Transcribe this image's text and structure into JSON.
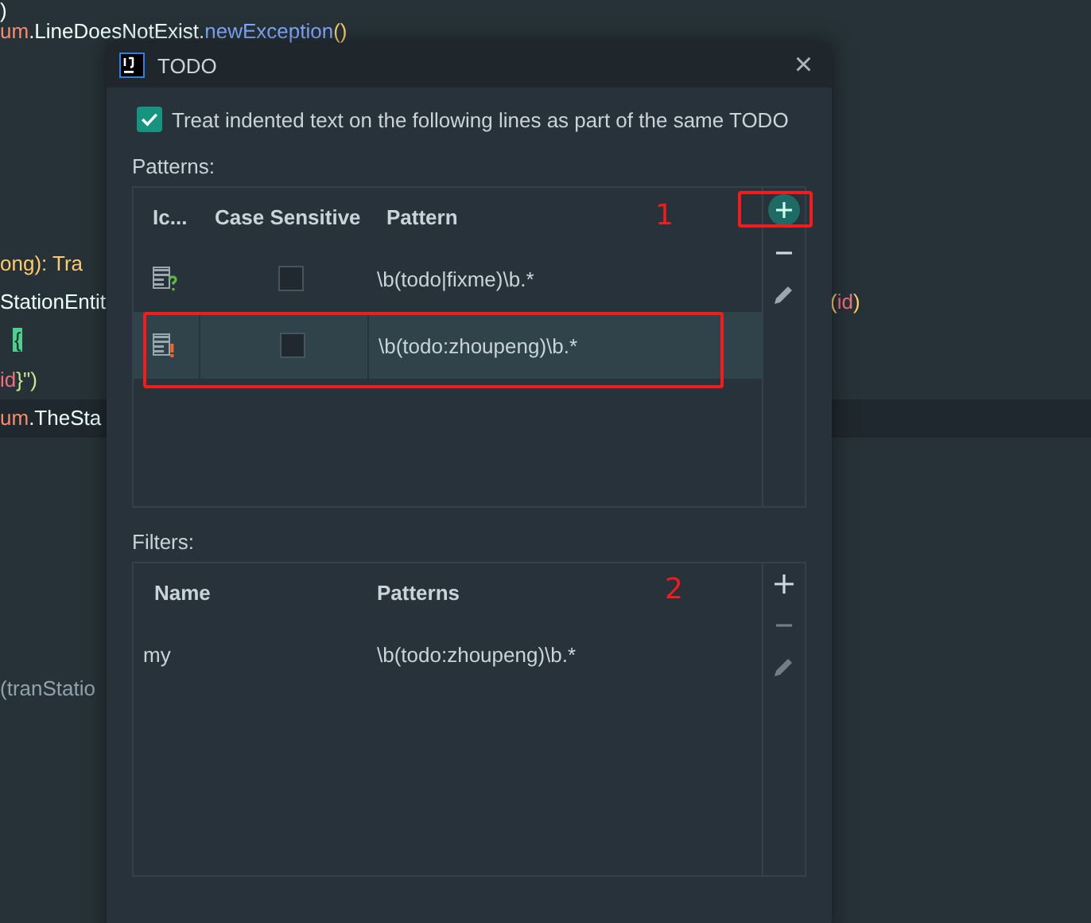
{
  "editor": {
    "lines": [
      {
        "kind": "code",
        "segments": [
          {
            "text": ")",
            "kind": "plain"
          }
        ]
      },
      {
        "kind": "code",
        "segments": [
          {
            "text": "um",
            "kind": "enum"
          },
          {
            "text": ".LineDoesNotExist.",
            "kind": "plain"
          },
          {
            "text": "newException",
            "kind": "method"
          },
          {
            "text": "()",
            "kind": "paren"
          }
        ]
      },
      {
        "kind": "blank"
      },
      {
        "kind": "blank"
      },
      {
        "kind": "blank"
      },
      {
        "kind": "blank"
      },
      {
        "kind": "blank"
      },
      {
        "kind": "code",
        "segments": [
          {
            "text": "ong): ",
            "kind": "paren"
          },
          {
            "text": "Tra",
            "kind": "paren"
          }
        ]
      },
      {
        "kind": "code",
        "segments": [
          {
            "text": "StationEntit",
            "kind": "plain"
          }
        ],
        "right": [
          {
            "text": "(",
            "kind": "paren"
          },
          {
            "text": "id",
            "kind": "param"
          },
          {
            "text": ")",
            "kind": "paren"
          }
        ]
      },
      {
        "kind": "code",
        "segments": [
          {
            "text": "{",
            "kind": "brace"
          }
        ]
      },
      {
        "kind": "code",
        "segments": [
          {
            "text": "id",
            "kind": "param"
          },
          {
            "text": "}\")",
            "kind": "string"
          }
        ]
      },
      {
        "kind": "current",
        "segments": [
          {
            "text": "um",
            "kind": "enum"
          },
          {
            "text": ".TheSta",
            "kind": "plain"
          }
        ]
      },
      {
        "kind": "blank"
      },
      {
        "kind": "blank"
      },
      {
        "kind": "blank"
      },
      {
        "kind": "blank"
      },
      {
        "kind": "blank"
      },
      {
        "kind": "blank"
      },
      {
        "kind": "code",
        "segments": [
          {
            "text": "(tranStatio",
            "kind": "comment"
          }
        ]
      }
    ]
  },
  "dialog": {
    "title": "TODO",
    "close": "×",
    "option": {
      "label": "Treat indented text on the following lines as part of the same TODO",
      "checked": true
    },
    "patterns": {
      "label": "Patterns:",
      "columns": [
        "Ic...",
        "Case Sensitive",
        "Pattern"
      ],
      "rows": [
        {
          "kind": "question",
          "case_sensitive": false,
          "pattern": "\\b(todo|fixme)\\b.*",
          "selected": false
        },
        {
          "kind": "exclamation",
          "case_sensitive": false,
          "pattern": "\\b(todo:zhoupeng)\\b.*",
          "selected": true
        }
      ]
    },
    "filters": {
      "label": "Filters:",
      "columns": [
        "Name",
        "Patterns"
      ],
      "rows": [
        {
          "name": "my",
          "patterns": "\\b(todo:zhoupeng)\\b.*",
          "selected": false
        }
      ]
    }
  },
  "annotations": [
    {
      "number": "1"
    },
    {
      "number": "2"
    }
  ]
}
